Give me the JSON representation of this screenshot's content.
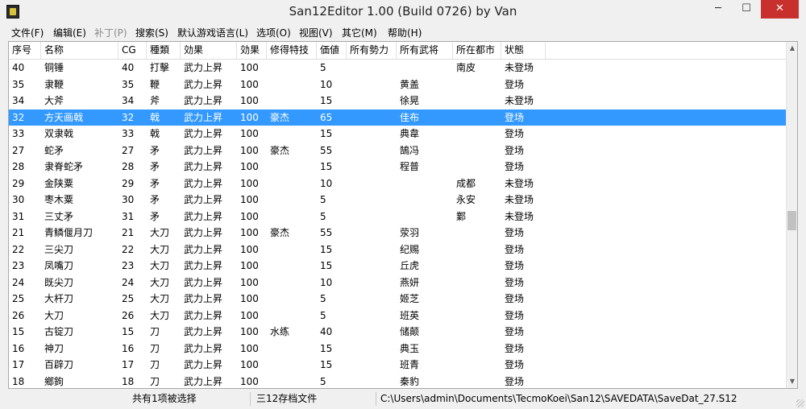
{
  "window": {
    "title": "San12Editor 1.00 (Build 0726) by Van"
  },
  "menu": [
    {
      "label": "文件(F)",
      "enabled": true
    },
    {
      "label": "编辑(E)",
      "enabled": true
    },
    {
      "label": "补丁(P)",
      "enabled": false
    },
    {
      "label": "搜索(S)",
      "enabled": true
    },
    {
      "label": "默认游戏语言(L)",
      "enabled": true
    },
    {
      "label": "选项(O)",
      "enabled": true
    },
    {
      "label": "视图(V)",
      "enabled": true
    },
    {
      "label": "其它(M)",
      "enabled": true
    },
    {
      "label": "帮助(H)",
      "enabled": true
    }
  ],
  "table": {
    "columns": [
      "序号",
      "名称",
      "CG",
      "種類",
      "効果",
      "効果",
      "修得特技",
      "価値",
      "所有勢力",
      "所有武将",
      "所在都市",
      "状態"
    ],
    "selected_index": 3,
    "rows": [
      [
        "40",
        "铜锤",
        "40",
        "打擊",
        "武力上昇",
        "100",
        "",
        "5",
        "",
        "",
        "南皮",
        "未登场"
      ],
      [
        "35",
        "隶鞭",
        "35",
        "鞭",
        "武力上昇",
        "100",
        "",
        "10",
        "",
        "黄盖",
        "",
        "登场"
      ],
      [
        "34",
        "大斧",
        "34",
        "斧",
        "武力上昇",
        "100",
        "",
        "15",
        "",
        "徐晃",
        "",
        "未登场"
      ],
      [
        "32",
        "方天画戟",
        "32",
        "戟",
        "武力上昇",
        "100",
        "豪杰",
        "65",
        "",
        "佳布",
        "",
        "登场"
      ],
      [
        "33",
        "双隶戟",
        "33",
        "戟",
        "武力上昇",
        "100",
        "",
        "15",
        "",
        "典韋",
        "",
        "登场"
      ],
      [
        "27",
        "蛇矛",
        "27",
        "矛",
        "武力上昇",
        "100",
        "豪杰",
        "55",
        "",
        "鵠冯",
        "",
        "登场"
      ],
      [
        "28",
        "隶脊蛇矛",
        "28",
        "矛",
        "武力上昇",
        "100",
        "",
        "15",
        "",
        "程普",
        "",
        "登场"
      ],
      [
        "29",
        "金陕粟",
        "29",
        "矛",
        "武力上昇",
        "100",
        "",
        "10",
        "",
        "",
        "成都",
        "未登场"
      ],
      [
        "30",
        "枣木粟",
        "30",
        "矛",
        "武力上昇",
        "100",
        "",
        "5",
        "",
        "",
        "永安",
        "未登场"
      ],
      [
        "31",
        "三丈矛",
        "31",
        "矛",
        "武力上昇",
        "100",
        "",
        "5",
        "",
        "",
        "鄴",
        "未登场"
      ],
      [
        "21",
        "青鳞偃月刀",
        "21",
        "大刀",
        "武力上昇",
        "100",
        "豪杰",
        "55",
        "",
        "荥羽",
        "",
        "登场"
      ],
      [
        "22",
        "三尖刀",
        "22",
        "大刀",
        "武力上昇",
        "100",
        "",
        "15",
        "",
        "纪赐",
        "",
        "登场"
      ],
      [
        "23",
        "凤嘴刀",
        "23",
        "大刀",
        "武力上昇",
        "100",
        "",
        "15",
        "",
        "丘虎",
        "",
        "登场"
      ],
      [
        "24",
        "既尖刀",
        "24",
        "大刀",
        "武力上昇",
        "100",
        "",
        "10",
        "",
        "燕妍",
        "",
        "登场"
      ],
      [
        "25",
        "大杆刀",
        "25",
        "大刀",
        "武力上昇",
        "100",
        "",
        "5",
        "",
        "姬芝",
        "",
        "登场"
      ],
      [
        "26",
        "大刀",
        "26",
        "大刀",
        "武力上昇",
        "100",
        "",
        "5",
        "",
        "班英",
        "",
        "登场"
      ],
      [
        "15",
        "古锭刀",
        "15",
        "刀",
        "武力上昇",
        "100",
        "水练",
        "40",
        "",
        "储颠",
        "",
        "登场"
      ],
      [
        "16",
        "神刀",
        "16",
        "刀",
        "武力上昇",
        "100",
        "",
        "15",
        "",
        "典玉",
        "",
        "登场"
      ],
      [
        "17",
        "百辟刀",
        "17",
        "刀",
        "武力上昇",
        "100",
        "",
        "15",
        "",
        "班青",
        "",
        "登场"
      ],
      [
        "18",
        "鄉鉤",
        "18",
        "刀",
        "武力上昇",
        "100",
        "",
        "5",
        "",
        "秦豹",
        "",
        "登场"
      ]
    ]
  },
  "status": {
    "selection": "共有1项被选择",
    "filetype": "三12存档文件",
    "path": "C:\\Users\\admin\\Documents\\TecmoKoei\\San12\\SAVEDATA\\SaveDat_27.S12"
  },
  "icons": {
    "app": "app-icon",
    "minimize": "minimize-icon",
    "maximize": "maximize-icon",
    "close": "close-icon",
    "scroll_up": "scroll-up-icon",
    "scroll_down": "scroll-down-icon"
  },
  "colors": {
    "selection": "#3399ff",
    "close_button": "#c7302c"
  }
}
